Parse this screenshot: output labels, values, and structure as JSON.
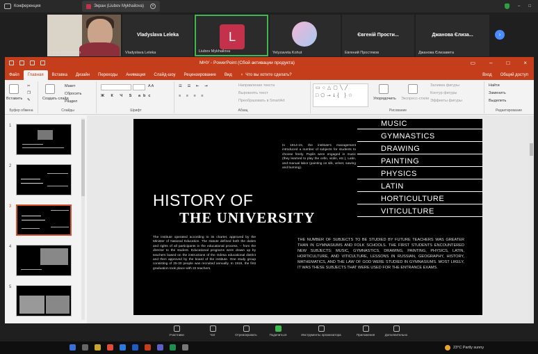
{
  "teams": {
    "top_left_label": "Конференция",
    "share_tab_label": "Экран (Liubov Mykhailova)",
    "colors": {
      "accent_share": "#c4314b",
      "active_border": "#3fb950",
      "ppt_red": "#c43e1c"
    }
  },
  "participants": [
    {
      "name": "Larisa Dovzhenko",
      "kind": "video"
    },
    {
      "name": "Vladyslava Leleka",
      "title": "Vladyslava Leleka",
      "kind": "name"
    },
    {
      "name": "Liubov Mykhailova",
      "avatar": "L",
      "kind": "avatar",
      "active": true
    },
    {
      "name": "Yelyzaveta Kohut",
      "kind": "avatar-img"
    },
    {
      "name": "Евгений Простяков",
      "title": "Євгеній Прости...",
      "kind": "name"
    },
    {
      "name": "Джанова Єлизавета",
      "title": "Джанова Єлиза...",
      "kind": "name"
    }
  ],
  "ppt": {
    "title": "МНУ - PowerPoint (Сбой активации продукта)",
    "tabs": [
      "Файл",
      "Главная",
      "Вставка",
      "Дизайн",
      "Переходы",
      "Анимация",
      "Слайд-шоу",
      "Рецензирование",
      "Вид"
    ],
    "tell_me": "Что вы хотите сделать?",
    "sign_in": "Вход",
    "share": "Общий доступ",
    "ribbon": {
      "paste": "Вставить",
      "clipboard_label": "Буфер обмена",
      "new_slide": "Создать слайд",
      "layout": "Макет",
      "reset": "Сбросить",
      "section": "Раздел",
      "slides_label": "Слайды",
      "font_label": "Шрифт",
      "text_direction": "Направление текста",
      "align_text": "Выровнять текст",
      "smartart": "Преобразовать в SmartArt",
      "paragraph_label": "Абзац",
      "arrange": "Упорядочить",
      "quick_styles": "Экспресс-стили",
      "shape_fill": "Заливка фигуры",
      "shape_outline": "Контур фигуры",
      "shape_effects": "Эффекты фигуры",
      "drawing_label": "Рисование",
      "find": "Найти",
      "replace": "Заменить",
      "select": "Выделить",
      "editing_label": "Редактирование"
    }
  },
  "thumbs": [
    "1",
    "2",
    "3",
    "4",
    "5"
  ],
  "slide": {
    "subjects": [
      "MUSIC",
      "GYMNASTICS",
      "DRAWING",
      "PAINTING",
      "PHYSICS",
      "LATIN",
      "HORTICULTURE",
      "VITICULTURE"
    ],
    "heading_line1": "HISTORY OF",
    "heading_line2": "THE UNIVERSITY",
    "para_top": "In 1914-15, the institute's management introduced a number of subjects for students to choose freely. Pupils were engaged in music (they learned to play the cello, violin, etc.), Latin, and manual labor (painting on silk, velvet, sawing and burning).",
    "para_left": "The institute operated according to its charter, approved by the Minister of National Education. The statute defined both the duties and rights of all participants in the educational process, – from the director to the student. Educational programs were drawn up by teachers based on the instructions of the Odesa educational district and then approved by the board of the institute. One study group consisting of 25-30 people was recruited annually. In 1916, the first graduation took place with 22 teachers.",
    "para_right": "THE NUMBER OF SUBJECTS TO BE STUDIED BY FUTURE TEACHERS WAS GREATER THAN IN GYMNASIUMS AND FOLK SCHOOLS. THE FIRST STUDENTS ENCOUNTERED NEW SUBJECTS: MUSIC, GYMNASTICS, DRAWING, PAINTING, PHYSICS, LATIN, HORTICULTURE, AND VITICULTURE, LESSONS IN RUSSIAN, GEOGRAPHY, HISTORY, MATHEMATICS, AND THE LAW OF GOD WERE STUDIED IN GYMNASIUMS. MOST LIKELY, IT WAS THESE SUBJECTS THAT WERE USED FOR THE ENTRANCE EXAMS."
  },
  "controls": [
    "Участники",
    "Чат",
    "Отреагировать",
    "Поделиться",
    "Инструменты организатора",
    "Приложения",
    "Дополнительно"
  ],
  "taskbar": {
    "weather": "23°C  Partly sunny"
  }
}
